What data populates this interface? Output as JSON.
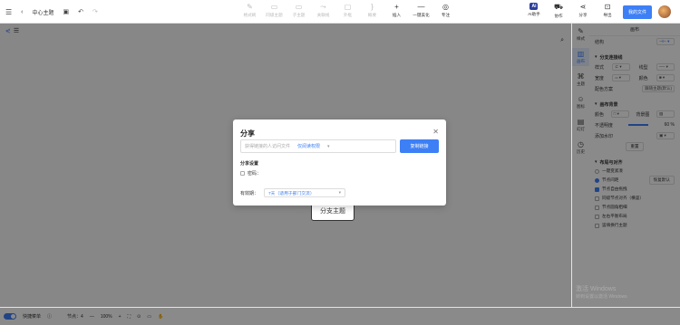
{
  "header": {
    "title": "中心主题",
    "tools": [
      {
        "label": "格式刷",
        "icon": "brush-icon",
        "glyph": "✎",
        "active": false
      },
      {
        "label": "同级主题",
        "icon": "sibling-topic-icon",
        "glyph": "▭",
        "active": false
      },
      {
        "label": "子主题",
        "icon": "child-topic-icon",
        "glyph": "▭",
        "active": false
      },
      {
        "label": "关联线",
        "icon": "relation-line-icon",
        "glyph": "⤳",
        "active": false
      },
      {
        "label": "外框",
        "icon": "boundary-icon",
        "glyph": "▢",
        "active": false
      },
      {
        "label": "概要",
        "icon": "summary-icon",
        "glyph": "}",
        "active": false
      },
      {
        "label": "插入",
        "icon": "insert-icon",
        "glyph": "+",
        "active": true
      },
      {
        "label": "一键美化",
        "icon": "beautify-icon",
        "glyph": "—",
        "active": true
      },
      {
        "label": "专注",
        "icon": "focus-icon",
        "glyph": "◎",
        "active": true
      }
    ],
    "right_tools": [
      {
        "label": "协作",
        "icon": "collaborate-icon",
        "glyph": "⛟"
      },
      {
        "label": "分享",
        "icon": "share-icon",
        "glyph": "⋖"
      },
      {
        "label": "导出",
        "icon": "export-icon",
        "glyph": "⊡"
      }
    ],
    "ai_badge": "Ai",
    "ai_label": "AI助手",
    "my_files": "我的文件"
  },
  "side_tabs": [
    {
      "label": "样式",
      "icon": "style-icon",
      "glyph": "✎",
      "active": false
    },
    {
      "label": "画布",
      "icon": "canvas-icon",
      "glyph": "▥",
      "active": true
    },
    {
      "label": "主题",
      "icon": "theme-icon",
      "glyph": "⌘",
      "active": false
    },
    {
      "label": "图标",
      "icon": "emoji-icon",
      "glyph": "☺",
      "active": false
    },
    {
      "label": "幻灯",
      "icon": "slides-icon",
      "glyph": "▤",
      "active": false
    },
    {
      "label": "历史",
      "icon": "history-icon",
      "glyph": "◷",
      "active": false
    }
  ],
  "panel": {
    "header": "画布",
    "structure_label": "结构",
    "branch_section": "分支连接线",
    "style_label": "样式",
    "line_label": "线型",
    "width_label": "宽度",
    "color_label": "颜色",
    "color_scheme_label": "配色方案",
    "color_scheme_value": "跟随主题(默认)",
    "bg_section": "画布背景",
    "bg_color_label": "颜色",
    "bg_image_label": "背景图",
    "opacity_label": "不透明度",
    "opacity_value": "60",
    "opacity_unit": "%",
    "watermark_label": "添加水印",
    "reset_label": "重置",
    "layout_section": "布局与对齐",
    "align_auto": "一键变紧凑",
    "node_spacing": "节点间距",
    "node_spacing_btn": "恢复默认",
    "opts": [
      {
        "label": "节点自由拖拽",
        "on": true
      },
      {
        "label": "同级节点对齐（横竖）",
        "on": false
      },
      {
        "label": "节点圆角粗细",
        "on": false
      },
      {
        "label": "左右平衡布局",
        "on": false
      },
      {
        "label": "竖填换行主题",
        "on": false
      }
    ]
  },
  "canvas": {
    "node_label": "分支主题",
    "watermark_line1": "激活 Windows",
    "watermark_line2": "转到设置以激活 Windows"
  },
  "status": {
    "mode_label": "快捷菜单",
    "nodes_label": "节点：4",
    "zoom": "100%"
  },
  "dialog": {
    "title": "分享",
    "link_placeholder": "获得链接的人访问文件",
    "permission": "仅阅读权限",
    "copy_button": "复制链接",
    "settings_label": "分享设置",
    "password_label": "密码：",
    "validity_label": "有效期：",
    "validity_value": "7天（适用于部门交流）"
  },
  "colors": {
    "accent": "#3d7ff5",
    "overlay": "rgba(0,0,0,0.46)"
  }
}
